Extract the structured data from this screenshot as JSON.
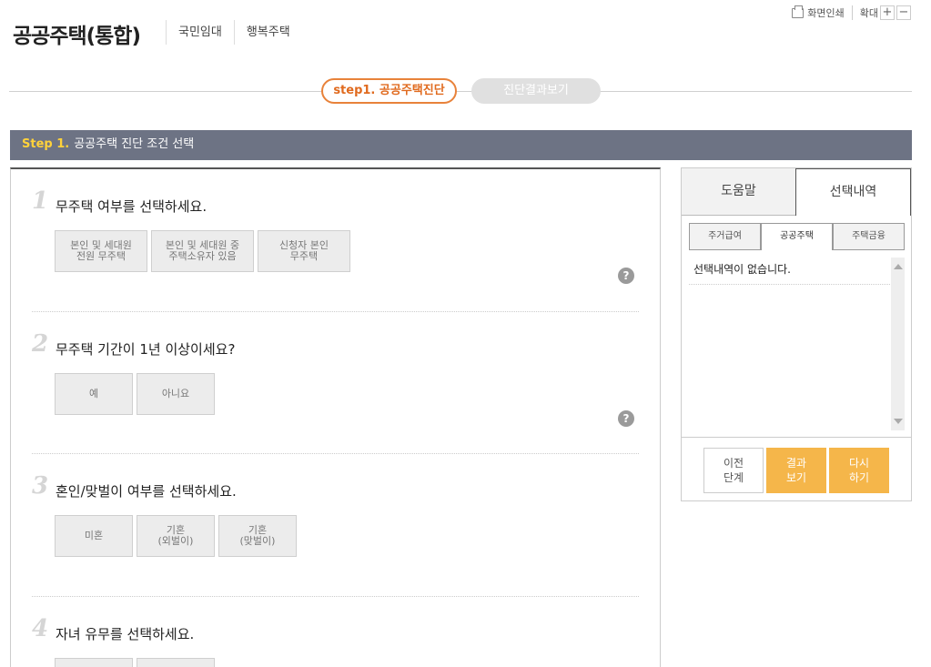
{
  "header": {
    "title": "공공주택(통합)",
    "nav": [
      "국민임대",
      "행복주택"
    ]
  },
  "utility": {
    "print_label": "화면인쇄",
    "zoom_label": "확대",
    "zoom_in": "+",
    "zoom_out": "−"
  },
  "steps": {
    "active": "step1. 공공주택진단",
    "inactive": "진단결과보기"
  },
  "section": {
    "step_no": "Step 1.",
    "title": "공공주택 진단 조건 선택"
  },
  "questions": [
    {
      "num": "1",
      "text": "무주택 여부를 선택하세요.",
      "options": [
        "본인 및 세대원\n전원 무주택",
        "본인 및 세대원 중\n주택소유자 있음",
        "신청자 본인\n무주택"
      ]
    },
    {
      "num": "2",
      "text": "무주택 기간이 1년 이상이세요?",
      "options": [
        "예",
        "아니요"
      ]
    },
    {
      "num": "3",
      "text": "혼인/맞벌이 여부를 선택하세요.",
      "options": [
        "미혼",
        "기혼\n(외벌이)",
        "기혼\n(맞벌이)"
      ]
    },
    {
      "num": "4",
      "text": "자녀 유무를 선택하세요.",
      "options": [
        "",
        ""
      ]
    }
  ],
  "help_icon_label": "?",
  "right_panel": {
    "tabs": [
      "도움말",
      "선택내역"
    ],
    "subtabs": [
      "주거급여",
      "공공주택",
      "주택금융"
    ],
    "empty_message": "선택내역이 없습니다.",
    "buttons": {
      "prev": "이전\n단계",
      "result": "결과\n보기",
      "retry": "다시\n하기"
    }
  },
  "colors": {
    "accent_orange": "#e8823a",
    "bar": "#6d7384",
    "step_yellow": "#ffd23a",
    "button_orange": "#f5b64a"
  }
}
